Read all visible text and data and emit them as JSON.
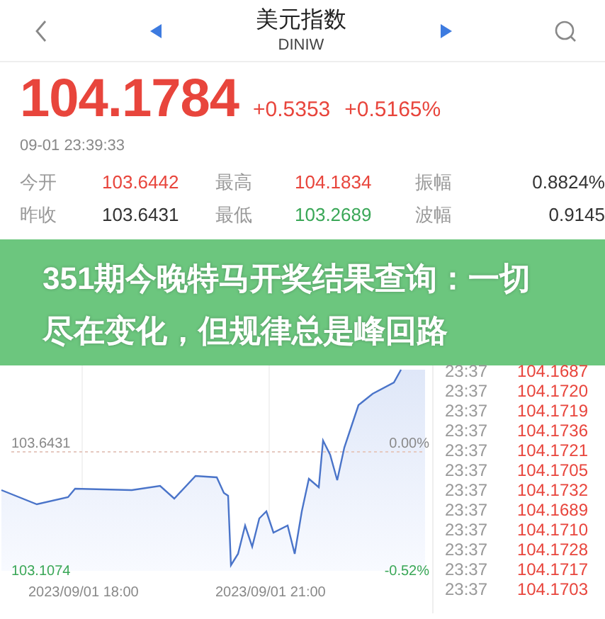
{
  "header": {
    "title": "美元指数",
    "subtitle": "DINIW"
  },
  "quote": {
    "price": "104.1784",
    "change": "+0.5353",
    "change_pct": "+0.5165%",
    "color": "#e8453c",
    "time": "09-01 23:39:33"
  },
  "stats": [
    {
      "label": "今开",
      "value": "103.6442",
      "color": "#e8453c"
    },
    {
      "label": "最高",
      "value": "104.1834",
      "color": "#e8453c"
    },
    {
      "label": "振幅",
      "value": "0.8824%",
      "color": "#333333"
    },
    {
      "label": "昨收",
      "value": "103.6431",
      "color": "#333333"
    },
    {
      "label": "最低",
      "value": "103.2689",
      "color": "#3aa757"
    },
    {
      "label": "波幅",
      "value": "0.9145",
      "color": "#333333"
    }
  ],
  "banner": {
    "text": "351期今晚特马开奖结果查询：一切尽在变化，但规律总是峰回路"
  },
  "chart": {
    "prev_close": "103.6431",
    "zero_pct": "0.00%",
    "low": "103.1074",
    "low_pct": "-0.52%",
    "x_labels": [
      "2023/09/01 18:00",
      "2023/09/01 21:00"
    ]
  },
  "trades": [
    {
      "time": "23:37",
      "price": "104.1687",
      "color": "#e8453c"
    },
    {
      "time": "23:37",
      "price": "104.1720",
      "color": "#e8453c"
    },
    {
      "time": "23:37",
      "price": "104.1719",
      "color": "#e8453c"
    },
    {
      "time": "23:37",
      "price": "104.1736",
      "color": "#e8453c"
    },
    {
      "time": "23:37",
      "price": "104.1721",
      "color": "#e8453c"
    },
    {
      "time": "23:37",
      "price": "104.1705",
      "color": "#e8453c"
    },
    {
      "time": "23:37",
      "price": "104.1732",
      "color": "#e8453c"
    },
    {
      "time": "23:37",
      "price": "104.1689",
      "color": "#e8453c"
    },
    {
      "time": "23:37",
      "price": "104.1710",
      "color": "#e8453c"
    },
    {
      "time": "23:37",
      "price": "104.1728",
      "color": "#e8453c"
    },
    {
      "time": "23:37",
      "price": "104.1717",
      "color": "#e8453c"
    },
    {
      "time": "23:37",
      "price": "104.1703",
      "color": "#e8453c"
    }
  ]
}
